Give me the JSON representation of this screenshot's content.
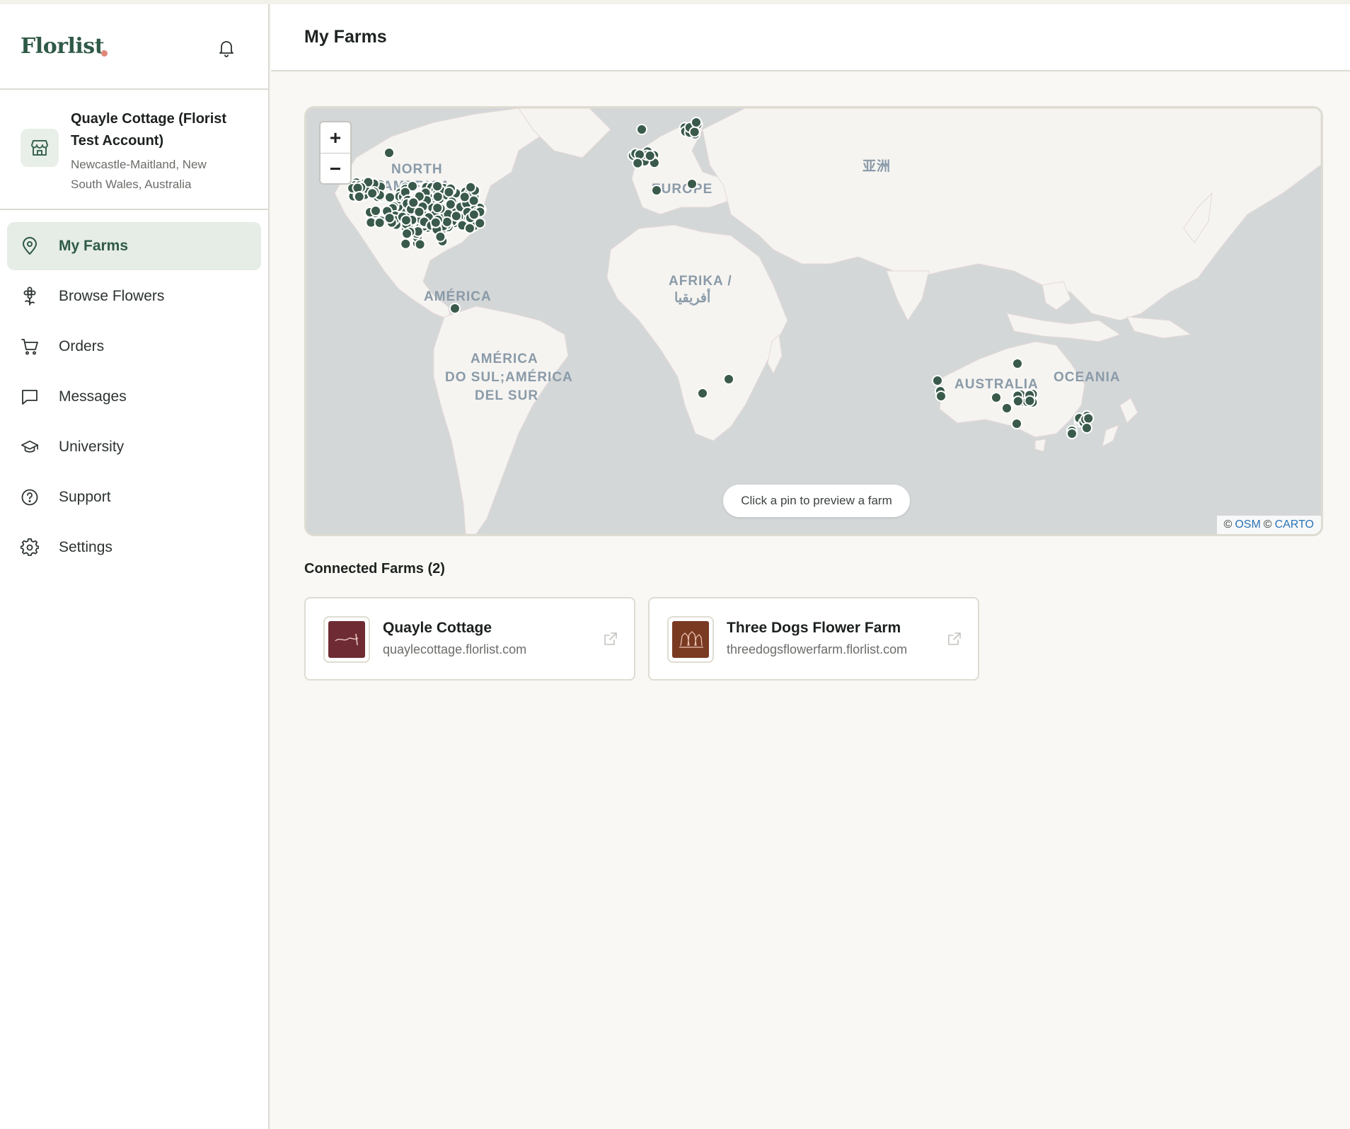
{
  "app": {
    "brand": "Florlist"
  },
  "account": {
    "name": "Quayle Cottage (Florist Test Account)",
    "location": "Newcastle-Maitland, New South Wales, Australia"
  },
  "nav": {
    "items": [
      {
        "label": "My Farms",
        "icon": "map-pin-icon",
        "active": true
      },
      {
        "label": "Browse Flowers",
        "icon": "flower-icon"
      },
      {
        "label": "Orders",
        "icon": "cart-icon"
      },
      {
        "label": "Messages",
        "icon": "message-icon"
      },
      {
        "label": "University",
        "icon": "graduation-cap-icon"
      },
      {
        "label": "Support",
        "icon": "help-circle-icon"
      },
      {
        "label": "Settings",
        "icon": "gear-icon"
      }
    ]
  },
  "header": {
    "title": "My Farms"
  },
  "map": {
    "zoom_in": "+",
    "zoom_out": "−",
    "hint": "Click a pin to preview a farm",
    "attribution": {
      "copy": "©",
      "osm": "OSM",
      "carto": "CARTO"
    },
    "labels": {
      "north_america_1": "NORTH",
      "north_america_2": "AMERICA",
      "europe": "EUROPE",
      "asia": "亚洲",
      "africa_1": "AFRIKA /",
      "africa_2": "أفريقيا",
      "america": "AMÉRICA",
      "south_america_1": "AMÉRICA",
      "south_america_2": "DO SUL;AMÉRICA",
      "south_america_3": "DEL SUR",
      "australia": "AUSTRALIA",
      "oceania": "OCEANIA"
    },
    "pin_color": "#3a5a4b"
  },
  "connected": {
    "title": "Connected Farms (2)",
    "farms": [
      {
        "name": "Quayle Cottage",
        "url": "quaylecottage.florlist.com",
        "logo_color": "#6e2b33"
      },
      {
        "name": "Three Dogs Flower Farm",
        "url": "threedogsflowerfarm.florlist.com",
        "logo_color": "#7a3a22"
      }
    ]
  },
  "colors": {
    "accent": "#2f5a47",
    "brand_dot": "#e0877b",
    "active_bg": "#e6ece6"
  }
}
